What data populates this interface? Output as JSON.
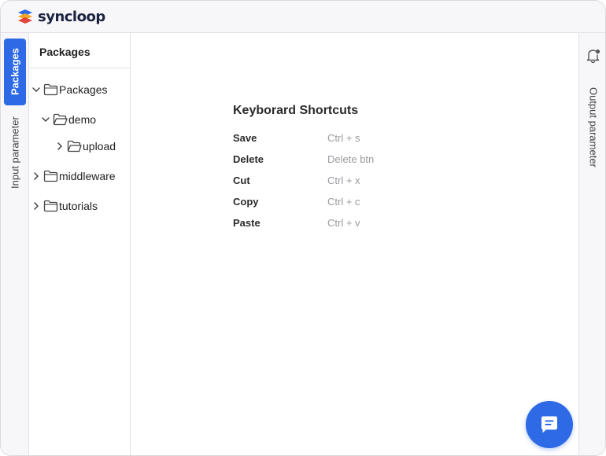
{
  "app": {
    "logo_text": "syncloop",
    "brand_color": "#2e6ae6"
  },
  "left_tabs": [
    {
      "label": "Packages",
      "active": true
    },
    {
      "label": "Input parameter",
      "active": false
    }
  ],
  "tree": {
    "title": "Packages",
    "items": [
      {
        "label": "Packages",
        "expanded": true
      },
      {
        "label": "demo",
        "expanded": true
      },
      {
        "label": "upload",
        "expanded": false
      },
      {
        "label": "middleware",
        "expanded": false
      },
      {
        "label": "tutorials",
        "expanded": false
      }
    ]
  },
  "right_tabs": {
    "label": "Output parameter",
    "icon": "bell-icon"
  },
  "shortcuts": {
    "title": "Keyborard Shortcuts",
    "rows": [
      {
        "action": "Save",
        "keys": "Ctrl + s"
      },
      {
        "action": "Delete",
        "keys": "Delete btn"
      },
      {
        "action": "Cut",
        "keys": "Ctrl + x"
      },
      {
        "action": "Copy",
        "keys": "Ctrl + c"
      },
      {
        "action": "Paste",
        "keys": "Ctrl + v"
      }
    ]
  },
  "chat_button": {
    "icon": "chat-icon"
  }
}
